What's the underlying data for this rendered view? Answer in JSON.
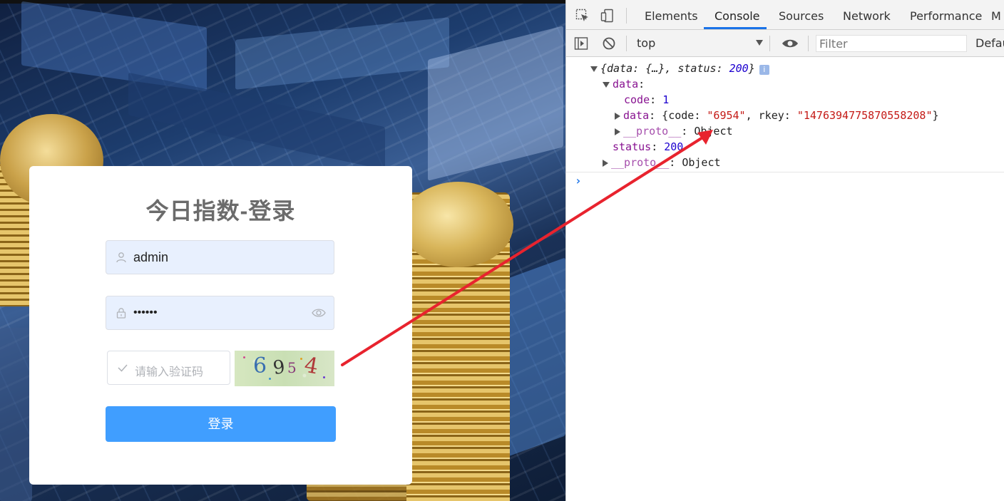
{
  "login": {
    "title": "今日指数-登录",
    "username_value": "admin",
    "password_mask": "••••••",
    "captcha_placeholder": "请输入验证码",
    "captcha_chars": [
      "6",
      "9",
      "5",
      "4"
    ],
    "login_button": "登录"
  },
  "devtools": {
    "tabs": [
      "Elements",
      "Console",
      "Sources",
      "Network",
      "Performance",
      "M"
    ],
    "active_tab": "Console",
    "context": "top",
    "filter_placeholder": "Filter",
    "levels_label": "Defau",
    "output": {
      "summary": {
        "open": "{",
        "k1": "data",
        "v1": "{…}",
        "k2": "status",
        "v2": "200",
        "close": "}",
        "badge": "i"
      },
      "data_key": "data",
      "code_key": "code",
      "code_value": "1",
      "inner_data_key": "data",
      "inner_code_key": "code",
      "inner_code_value": "\"6954\"",
      "inner_rkey_key": "rkey",
      "inner_rkey_value": "\"1476394775870558208\"",
      "proto_key": "__proto__",
      "proto_value": "Object",
      "status_key": "status",
      "status_value": "200",
      "proto2_key": "__proto__",
      "proto2_value": "Object"
    },
    "prompt_symbol": "›"
  },
  "colors": {
    "accent_blue": "#409eff",
    "devtools_tab_underline": "#1a73e8",
    "annotation_arrow": "#e8232e"
  }
}
